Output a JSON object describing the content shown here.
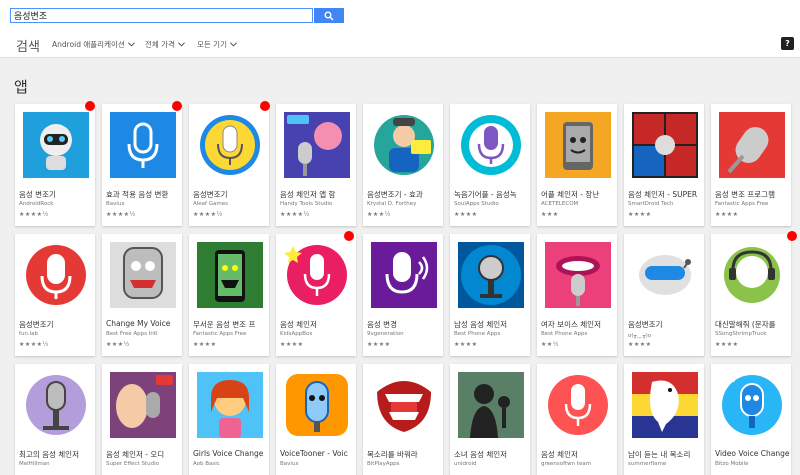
{
  "search": {
    "query": "음성변조"
  },
  "subbar": {
    "title": "검색",
    "filters": [
      "Android 애플리케이션",
      "전체 가격",
      "모든 기기"
    ],
    "help": "?"
  },
  "section": {
    "title": "앱"
  },
  "colors": {
    "accent": "#4285f4",
    "badge": "#ff0000"
  },
  "apps": [
    {
      "title": "음성 변조기",
      "dev": "AndroidRock",
      "stars": "★★★★½",
      "icon": "robot-icon",
      "badge": true
    },
    {
      "title": "효과 적용 음성 변환",
      "dev": "Baviux",
      "stars": "★★★★½",
      "icon": "microphone-icon",
      "badge": true
    },
    {
      "title": "음성변조기",
      "dev": "Aleaf Games",
      "stars": "★★★★½",
      "icon": "microphone-icon",
      "badge": true
    },
    {
      "title": "음성 체인저 앱 함",
      "dev": "Handy Tools Studio",
      "stars": "★★★★½",
      "icon": "microphone-icon",
      "badge": false
    },
    {
      "title": "음성변조기 - 효과",
      "dev": "Krystal D. Forthey",
      "stars": "★★★½",
      "icon": "person-icon",
      "badge": false
    },
    {
      "title": "녹음기어플 - 음성녹",
      "dev": "SoulApps Studio",
      "stars": "★★★★",
      "icon": "microphone-icon",
      "badge": false
    },
    {
      "title": "어플 체인저 - 장난",
      "dev": "ACETELECOM",
      "stars": "★★★",
      "icon": "phone-face-icon",
      "badge": false
    },
    {
      "title": "음성 체인저 - SUPER",
      "dev": "SmartDroid Tech",
      "stars": "★★★★",
      "icon": "superhero-icon",
      "badge": false
    },
    {
      "title": "음성 변조 프로그램",
      "dev": "Fantastic Apps Free",
      "stars": "★★★★",
      "icon": "microphone-icon",
      "badge": false
    },
    {
      "title": "음성변조기",
      "dev": "fun.lab",
      "stars": "★★★★½",
      "icon": "microphone-icon",
      "badge": false
    },
    {
      "title": "Change My Voice",
      "dev": "Best Free Apps Intl",
      "stars": "★★★½",
      "icon": "monster-mic-icon",
      "badge": false
    },
    {
      "title": "무서운 음성 변조 프",
      "dev": "Fantastic Apps Free",
      "stars": "★★★★",
      "icon": "monster-phone-icon",
      "badge": false
    },
    {
      "title": "음성 체인저",
      "dev": "KidsAppBox",
      "stars": "★★★★",
      "icon": "microphone-icon",
      "badge": true
    },
    {
      "title": "음성 변경",
      "dev": "9vgeneration",
      "stars": "★★★★",
      "icon": "speaking-mic-icon",
      "badge": false
    },
    {
      "title": "남성 음성 체인저",
      "dev": "Best Phone Apps",
      "stars": "★★★★",
      "icon": "microphone-icon",
      "badge": false
    },
    {
      "title": "여자 보이스 체인저",
      "dev": "Best Phone Apps",
      "stars": "★★½",
      "icon": "lips-mic-icon",
      "badge": false
    },
    {
      "title": "음성변조기",
      "dev": "o(╥﹏╥)o",
      "stars": "★★★★",
      "icon": "robot-face-icon",
      "badge": false
    },
    {
      "title": "대신말해줘 (문자를",
      "dev": "SSongShrimpTruck",
      "stars": "★★★★",
      "icon": "headset-face-icon",
      "badge": true
    },
    {
      "title": "최고의 음성 체인저",
      "dev": "MelHillman",
      "stars": "",
      "icon": "microphone-icon",
      "badge": false
    },
    {
      "title": "음성 체인저 - 오디",
      "dev": "Super Effect Studio",
      "stars": "",
      "icon": "woman-mic-icon",
      "badge": false
    },
    {
      "title": "Girls Voice Change",
      "dev": "Aob Basic",
      "stars": "",
      "icon": "girl-mic-icon",
      "badge": false
    },
    {
      "title": "VoiceTooner - Voic",
      "dev": "Baviux",
      "stars": "",
      "icon": "cartoon-mic-icon",
      "badge": false
    },
    {
      "title": "목소리를 바꿔라",
      "dev": "BitPlayApps",
      "stars": "",
      "icon": "mouth-icon",
      "badge": false
    },
    {
      "title": "소녀 음성 체인저",
      "dev": "unidroid",
      "stars": "",
      "icon": "girl-silhouette-icon",
      "badge": false
    },
    {
      "title": "음성 체인저",
      "dev": "greensoftwn team",
      "stars": "",
      "icon": "microphone-icon",
      "badge": false
    },
    {
      "title": "남이 듣는 내 목소리",
      "dev": "summerflame",
      "stars": "",
      "icon": "parrot-icon",
      "badge": false
    },
    {
      "title": "Video Voice Change",
      "dev": "Bitzo Mobile",
      "stars": "",
      "icon": "mic-mascot-icon",
      "badge": false
    }
  ]
}
